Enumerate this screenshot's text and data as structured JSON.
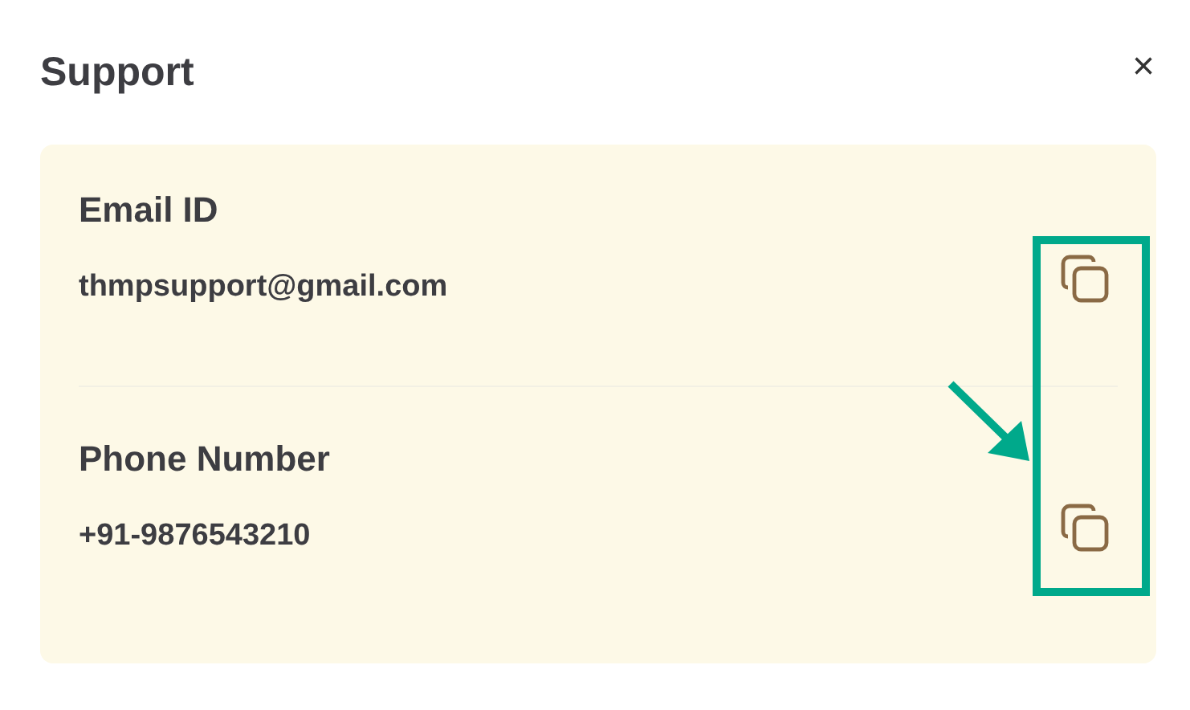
{
  "dialog": {
    "title": "Support",
    "close": "×"
  },
  "contacts": [
    {
      "label": "Email ID",
      "value": "thmpsupport@gmail.com"
    },
    {
      "label": "Phone Number",
      "value": "+91-9876543210"
    }
  ]
}
